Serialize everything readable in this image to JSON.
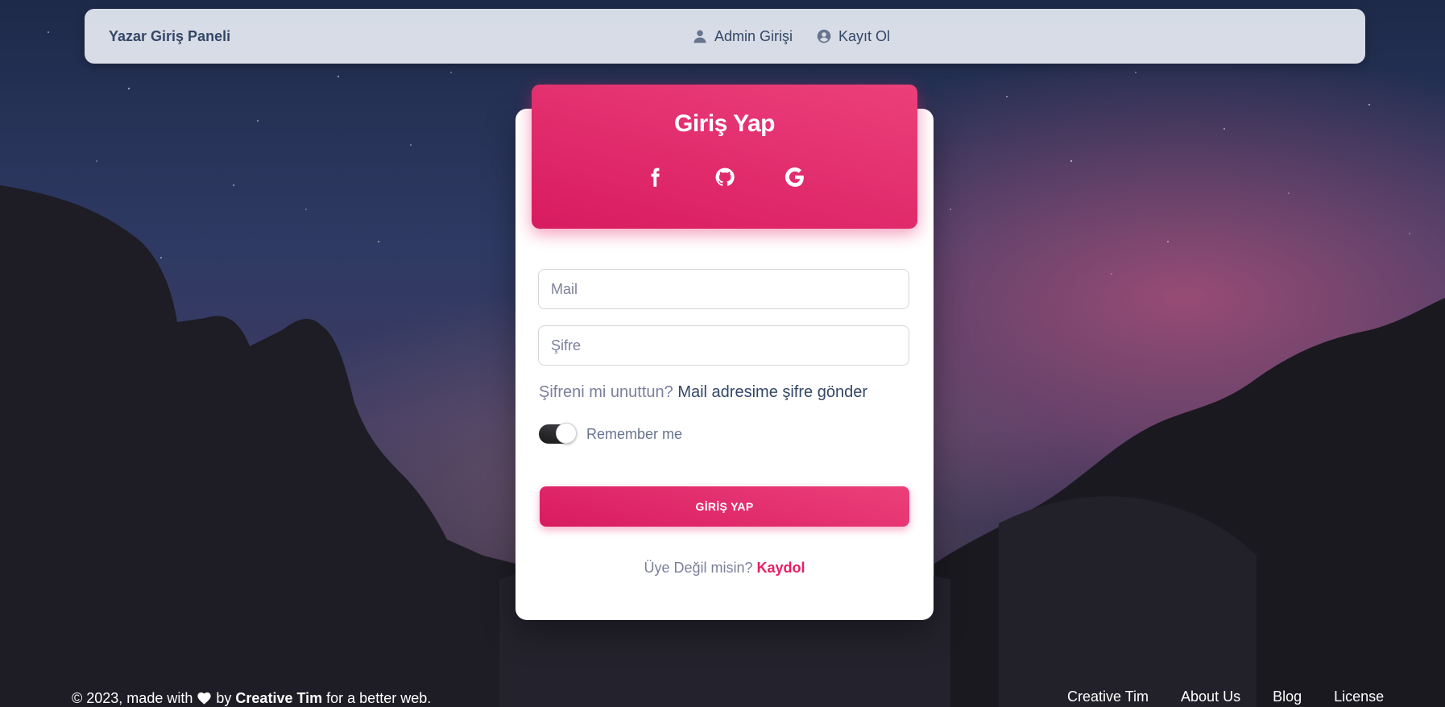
{
  "navbar": {
    "brand": "Yazar Giriş Paneli",
    "links": [
      {
        "label": "Admin Girişi",
        "icon": "user-icon"
      },
      {
        "label": "Kayıt Ol",
        "icon": "user-circle-icon"
      }
    ]
  },
  "login": {
    "title": "Giriş Yap",
    "socials": [
      "facebook-icon",
      "github-icon",
      "google-icon"
    ],
    "mail_placeholder": "Mail",
    "password_placeholder": "Şifre",
    "forgot_text": "Şifreni mi unuttun?",
    "forgot_link": "Mail adresime şifre gönder",
    "remember_label": "Remember me",
    "remember_checked": true,
    "submit_label": "GİRİŞ YAP",
    "signup_text": "Üye Değil misin?",
    "signup_link": "Kaydol"
  },
  "footer": {
    "prefix": "© 2023, made with",
    "by": "by",
    "author": "Creative Tim",
    "suffix": "for a better web.",
    "links": [
      "Creative Tim",
      "About Us",
      "Blog",
      "License"
    ]
  },
  "colors": {
    "primary": "#e91e63",
    "primary_light": "#ec407a",
    "text_dark": "#344767",
    "text_muted": "#7b809a"
  }
}
